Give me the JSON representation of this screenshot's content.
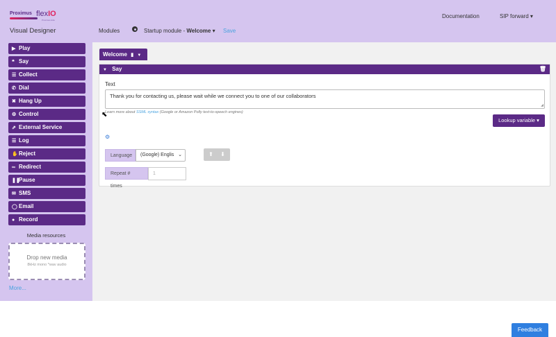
{
  "logo": {
    "brand": "Proximus",
    "product_prefix": "flex",
    "product_suffix": "IO",
    "sub": "Proximus Ada"
  },
  "app_title": "Visual Designer",
  "nav": {
    "documentation": "Documentation",
    "sip": "SIP forward ▾"
  },
  "breadcrumb": {
    "modules": "Modules",
    "module_prefix": "Startup module - ",
    "module_name": "Welcome",
    "module_caret": " ▾",
    "save": "Save"
  },
  "sidebar": {
    "actions": [
      {
        "label": "Play",
        "icon": "play-icon",
        "glyph": "▶"
      },
      {
        "label": "Say",
        "icon": "quote-icon",
        "glyph": "❝"
      },
      {
        "label": "Collect",
        "icon": "list-icon",
        "glyph": "☰"
      },
      {
        "label": "Dial",
        "icon": "phone-icon",
        "glyph": "✆"
      },
      {
        "label": "Hang Up",
        "icon": "close-icon",
        "glyph": "✖"
      },
      {
        "label": "Control",
        "icon": "gear-icon",
        "glyph": "⚙"
      },
      {
        "label": "External Service",
        "icon": "external-link-icon",
        "glyph": "⇗"
      },
      {
        "label": "Log",
        "icon": "list-icon",
        "glyph": "☰"
      },
      {
        "label": "Reject",
        "icon": "thumbs-down-icon",
        "glyph": "✋"
      },
      {
        "label": "Redirect",
        "icon": "link-icon",
        "glyph": "∞"
      },
      {
        "label": "Pause",
        "icon": "pause-icon",
        "glyph": "❚❚"
      },
      {
        "label": "SMS",
        "icon": "envelope-icon",
        "glyph": "✉"
      },
      {
        "label": "Email",
        "icon": "comment-icon",
        "glyph": "◯"
      },
      {
        "label": "Record",
        "icon": "microphone-icon",
        "glyph": "●"
      }
    ],
    "media_title": "Media resources",
    "drop_title": "Drop new media",
    "drop_sub": "8kHz mono *wav audio",
    "more": "More..."
  },
  "tab": {
    "label": "Welcome"
  },
  "panel": {
    "title": "Say",
    "text_label": "Text",
    "text_value": "Thank you for contacting us, please wait while we connect you to one of our collaborators",
    "hint_prefix": "Learn more about ",
    "hint_link": "SSML syntax",
    "hint_suffix": " (Google or Amazon Polly text-to-speech engines)",
    "lookup": "Lookup variable ▾",
    "language_label": "Language",
    "language_value": "(Google) Englis",
    "repeat_label": "Repeat # times",
    "repeat_placeholder": "1"
  },
  "feedback": "Feedback",
  "colors": {
    "primary": "#5b2a86",
    "header_bg": "#d5c5ef",
    "link": "#4aa3df",
    "feedback": "#2f7fe0"
  }
}
